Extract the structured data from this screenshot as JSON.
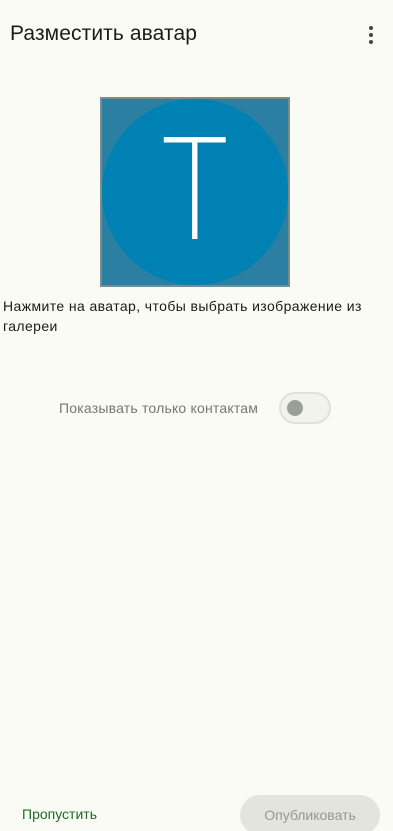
{
  "header": {
    "title": "Разместить аватар",
    "menu_icon": "more-vert-icon"
  },
  "avatar": {
    "letter": "T",
    "background_color": "#0081b3"
  },
  "hint": "Нажмите на аватар, чтобы выбрать изображение из галереи",
  "contacts_toggle": {
    "label": "Показывать только контактам",
    "checked": false
  },
  "footer": {
    "skip_label": "Пропустить",
    "publish_label": "Опубликовать",
    "publish_enabled": false
  }
}
